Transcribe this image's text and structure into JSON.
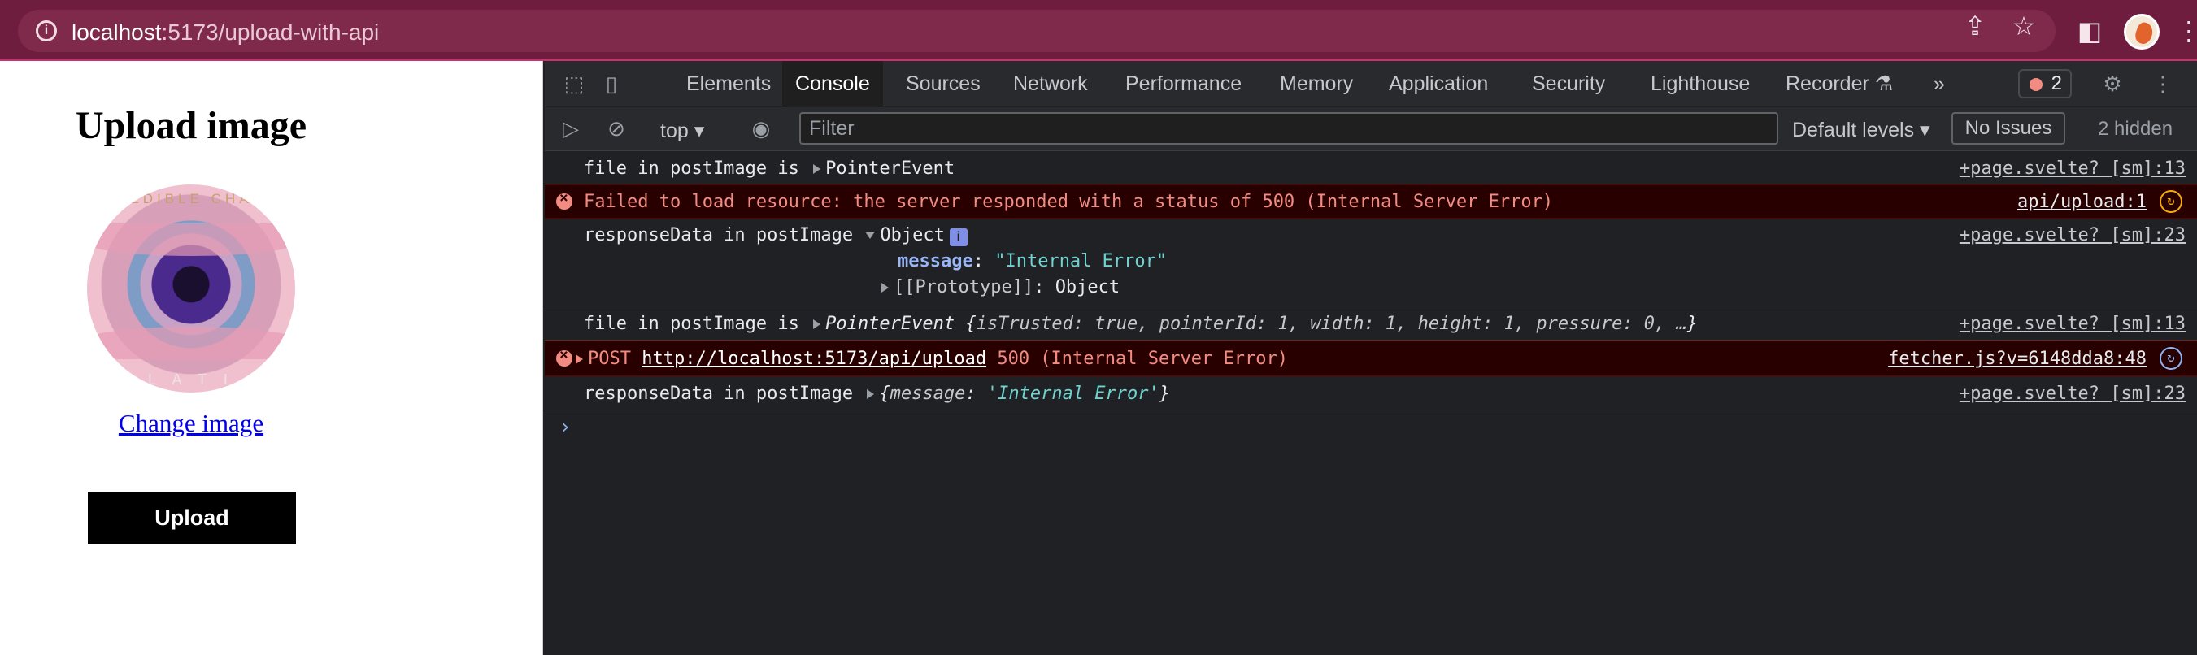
{
  "browser": {
    "url_host": "localhost",
    "url_path": ":5173/upload-with-api",
    "icons": [
      "info-icon",
      "share-icon",
      "star-icon",
      "sidepanel-icon",
      "profile-avatar",
      "menu-icon"
    ]
  },
  "page": {
    "title": "Upload image",
    "image_text_top": "EDIBLE CHA",
    "image_text_bottom": "L A T I",
    "change_link": "Change image",
    "upload_button": "Upload"
  },
  "devtools": {
    "tabs": [
      "Elements",
      "Console",
      "Sources",
      "Network",
      "Performance",
      "Memory",
      "Application",
      "Security",
      "Lighthouse",
      "Recorder"
    ],
    "active_tab": "Console",
    "more_tabs": "»",
    "error_count": "2",
    "context": "top",
    "filter_placeholder": "Filter",
    "levels": "Default levels",
    "issues": "No Issues",
    "hidden": "2 hidden"
  },
  "console": {
    "r1_msg": "file in postImage is",
    "r1_obj": "PointerEvent",
    "r1_src": "+page.svelte? [sm]:13",
    "r2_msg": "Failed to load resource: the server responded with a status of 500 (Internal Server Error)",
    "r2_src": "api/upload:1",
    "r3_msg": "responseData in postImage",
    "r3_obj": "Object",
    "r3_key": "message",
    "r3_val": "\"Internal Error\"",
    "r3_proto_key": "[[Prototype]]",
    "r3_proto_val": "Object",
    "r3_src": "+page.svelte? [sm]:23",
    "r4_msg": "file in postImage is",
    "r4_obj": "PointerEvent",
    "r4_props": "isTrusted: true, pointerId: 1, width: 1, height: 1, pressure: 0, …",
    "r4_src": "+page.svelte? [sm]:13",
    "r5_method": "POST",
    "r5_url": "http://localhost:5173/api/upload",
    "r5_status": "500 (Internal Server Error)",
    "r5_src": "fetcher.js?v=6148dda8:48",
    "r6_msg": "responseData in postImage",
    "r6_key": "message",
    "r6_val": "'Internal Error'",
    "r6_src": "+page.svelte? [sm]:23",
    "prompt": "›"
  }
}
